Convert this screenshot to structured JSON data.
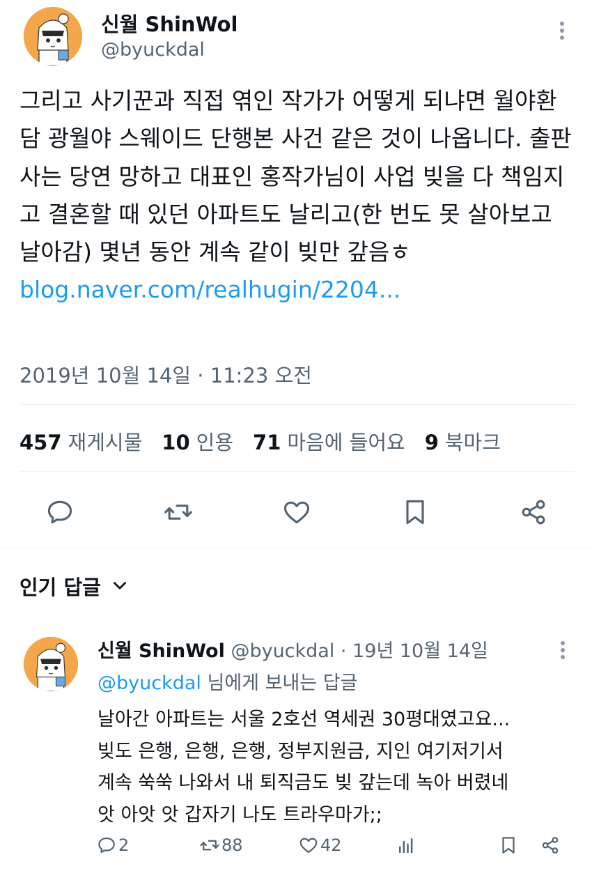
{
  "tweet": {
    "author_name": "신월 ShinWol",
    "author_handle": "@byuckdal",
    "body_text": "그리고 사기꾼과 직접 엮인 작가가 어떻게 되냐면 월야환담 광월야 스웨이드 단행본 사건 같은 것이 나옵니다. 출판사는 당연 망하고 대표인 홍작가님이 사업 빚을 다 책임지고 결혼할 때 있던 아파트도 날리고(한 번도 못 살아보고 날아감) 몇년 동안 계속 같이 빚만 갚음ㅎ",
    "link_text": "blog.naver.com/realhugin/2204...",
    "timestamp": "2019년 10월 14일 · 11:23 오전"
  },
  "stats": [
    {
      "num": "457",
      "label": "재게시물"
    },
    {
      "num": "10",
      "label": "인용"
    },
    {
      "num": "71",
      "label": "마음에 들어요"
    },
    {
      "num": "9",
      "label": "북마크"
    }
  ],
  "actions": {
    "reply_icon": "reply-icon",
    "retweet_icon": "retweet-icon",
    "like_icon": "heart-icon",
    "bookmark_icon": "bookmark-icon",
    "share_icon": "share-icon"
  },
  "popular_replies": {
    "label": "인기 답글"
  },
  "reply": {
    "author_name": "신월 ShinWol",
    "meta": "@byuckdal · 19년 10월 14일",
    "mention": "@byuckdal",
    "reply_to_suffix": "님에게 보내는 답글",
    "lines": [
      "날아간 아파트는 서울 2호선 역세권 30평대였고요...",
      "빚도 은행, 은행, 은행, 정부지원금, 지인 여기저기서",
      "계속 쑥쑥 나와서 내 퇴직금도 빚 갚는데 녹아 버렸네",
      "앗 아앗 앗 갑자기 나도 트라우마가;;"
    ],
    "reply_count": "2",
    "retweet_count": "88",
    "like_count": "42"
  },
  "colors": {
    "text": "#0f1419",
    "secondary": "#536471",
    "link": "#1d9bf0",
    "divider": "#eff3f4",
    "avatar_bg": "#f4a64a"
  }
}
